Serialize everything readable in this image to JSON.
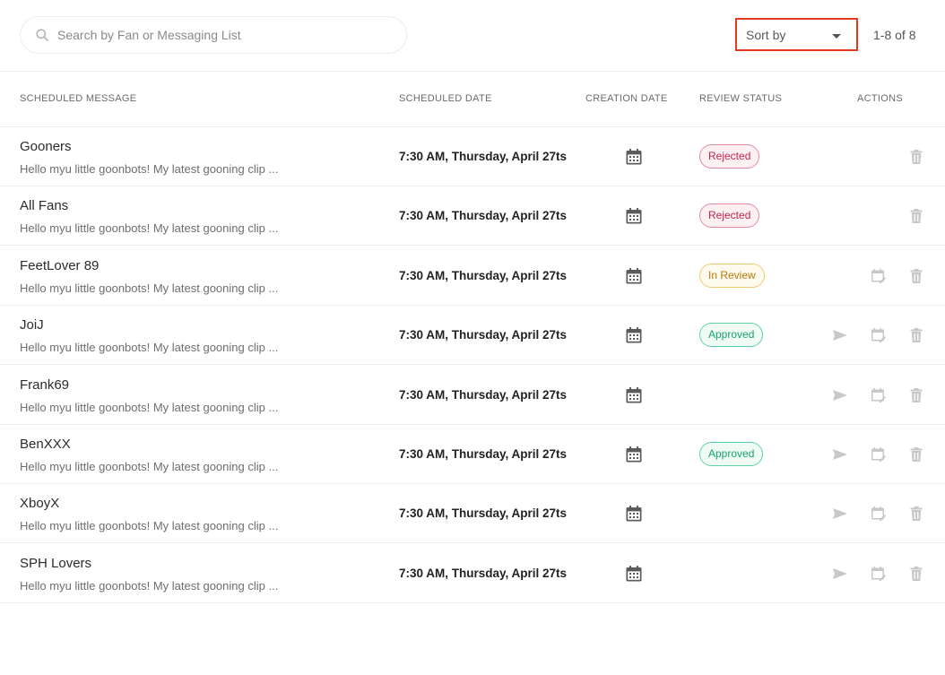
{
  "search": {
    "placeholder": "Search by Fan or Messaging List",
    "value": ""
  },
  "sort": {
    "label": "Sort by"
  },
  "pagination": {
    "range": "1-8 of 8"
  },
  "columns": {
    "scheduled_message": "SCHEDULED MESSAGE",
    "scheduled_date": "SCHEDULED DATE",
    "creation_date": "CREATION DATE",
    "review_status": "REVIEW STATUS",
    "actions": "ACTIONS"
  },
  "colors": {
    "sort_highlight": "#e23b1e",
    "rejected": "#c2254b",
    "in_review": "#b77a07",
    "approved": "#15a36f",
    "action_icon": "#c8c8c8"
  },
  "icons": {
    "search": "search-icon",
    "sort_caret": "caret-down-icon",
    "creation_date": "calendar-icon",
    "send": "send-icon",
    "reschedule": "calendar-edit-icon",
    "delete": "trash-icon"
  },
  "rows": [
    {
      "name": "Gooners",
      "message": "Hello myu little goonbots! My latest gooning clip ...",
      "scheduled_date": "7:30 AM, Thursday, April 27ts",
      "status": "Rejected",
      "status_kind": "rejected",
      "actions": [
        "delete"
      ]
    },
    {
      "name": "All Fans",
      "message": "Hello myu little goonbots! My latest gooning clip ...",
      "scheduled_date": "7:30 AM, Thursday, April 27ts",
      "status": "Rejected",
      "status_kind": "rejected",
      "actions": [
        "delete"
      ]
    },
    {
      "name": "FeetLover 89",
      "message": "Hello myu little goonbots! My latest gooning clip ...",
      "scheduled_date": "7:30 AM, Thursday, April 27ts",
      "status": "In Review",
      "status_kind": "review",
      "actions": [
        "reschedule",
        "delete"
      ]
    },
    {
      "name": "JoiJ",
      "message": "Hello myu little goonbots! My latest gooning clip ...",
      "scheduled_date": "7:30 AM, Thursday, April 27ts",
      "status": "Approved",
      "status_kind": "approved",
      "actions": [
        "send",
        "reschedule",
        "delete"
      ]
    },
    {
      "name": "Frank69",
      "message": "Hello myu little goonbots! My latest gooning clip ...",
      "scheduled_date": "7:30 AM, Thursday, April 27ts",
      "status": "",
      "status_kind": "",
      "actions": [
        "send",
        "reschedule",
        "delete"
      ]
    },
    {
      "name": "BenXXX",
      "message": "Hello myu little goonbots! My latest gooning clip ...",
      "scheduled_date": "7:30 AM, Thursday, April 27ts",
      "status": "Approved",
      "status_kind": "approved",
      "actions": [
        "send",
        "reschedule",
        "delete"
      ]
    },
    {
      "name": "XboyX",
      "message": "Hello myu little goonbots! My latest gooning clip ...",
      "scheduled_date": "7:30 AM, Thursday, April 27ts",
      "status": "",
      "status_kind": "",
      "actions": [
        "send",
        "reschedule",
        "delete"
      ]
    },
    {
      "name": "SPH Lovers",
      "message": "Hello myu little goonbots! My latest gooning clip ...",
      "scheduled_date": "7:30 AM, Thursday, April 27ts",
      "status": "",
      "status_kind": "",
      "actions": [
        "send",
        "reschedule",
        "delete"
      ]
    }
  ]
}
